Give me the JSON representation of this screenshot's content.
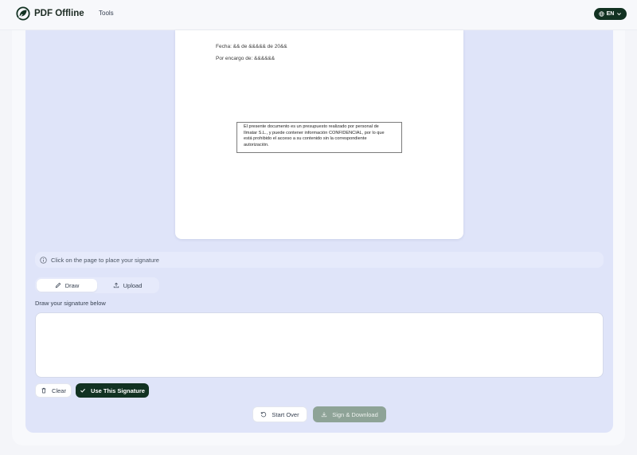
{
  "header": {
    "app_name": "PDF Offline",
    "nav_tools": "Tools",
    "language": "EN",
    "logo_icon": "leaf-logo-icon",
    "brand_color": "#123222"
  },
  "document": {
    "fecha_line": "Fecha: && de &&&&& de 20&&",
    "encargo_line": "Por encargo de: &&&&&&",
    "notice_lines": [
      "El presente documento es un presupuesto realizado por personal de",
      "Ilmatar S.L., y puede contener información CONFIDENCIAL, por lo que",
      "está prohibido el acceso a su contenido sin la correspondiente",
      "autorización."
    ]
  },
  "hint": {
    "text": "Click on the page to place your signature",
    "icon": "info-icon"
  },
  "tabs": {
    "draw_label": "Draw",
    "upload_label": "Upload",
    "selected": "Draw"
  },
  "signature": {
    "prompt": "Draw your signature below"
  },
  "actions": {
    "clear_label": "Clear",
    "use_label": "Use This Signature",
    "start_over_label": "Start Over",
    "sign_download_label": "Sign & Download"
  }
}
